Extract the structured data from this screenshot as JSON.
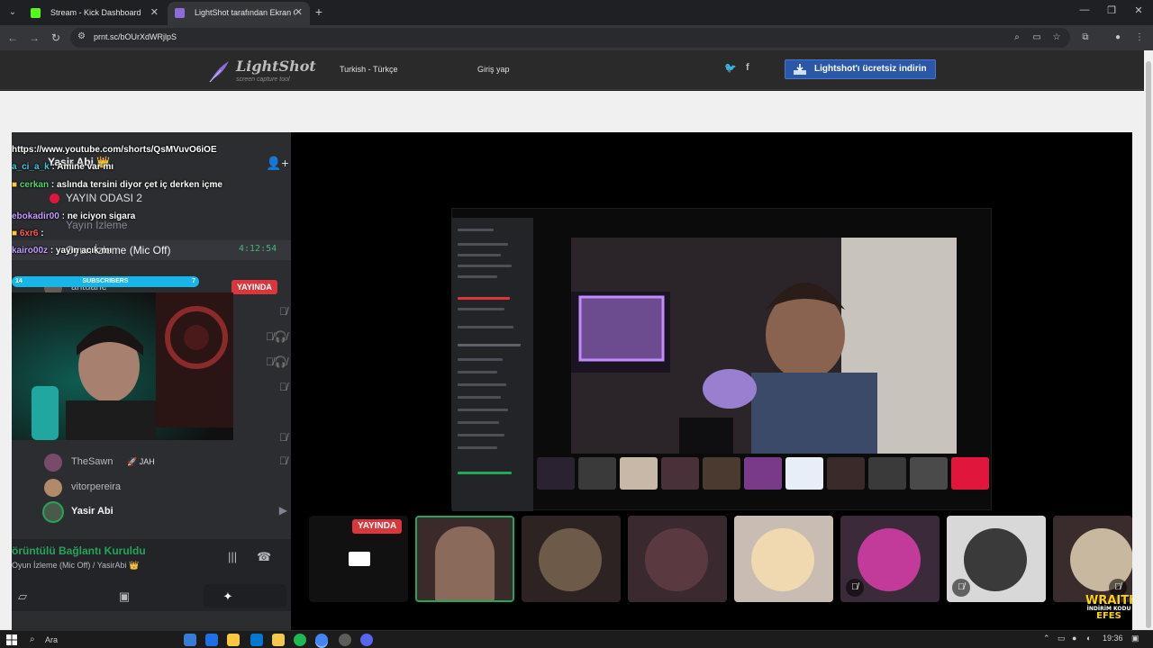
{
  "browser": {
    "tabs": [
      {
        "title": "Stream - Kick Dashboard",
        "favicon_color": "#53fc18",
        "active": false
      },
      {
        "title": "LightShot tarafından Ekran Gör",
        "favicon_color": "#8e6cd8",
        "active": true
      }
    ],
    "url": "prnt.sc/bOUrXdWRjlpS",
    "icons": {
      "back": "back-arrow-icon",
      "forward": "forward-arrow-icon",
      "reload": "reload-icon",
      "zoom": "zoom-icon",
      "cast": "cast-icon",
      "bookmark": "star-icon",
      "extensions": "puzzle-icon",
      "profile": "profile-icon",
      "menu": "kebab-menu-icon"
    }
  },
  "lightshot": {
    "logo": "LightShot",
    "tagline": "screen capture tool",
    "language": "Turkish - Türkçe",
    "login": "Giriş yap",
    "twitter": "twitter-icon",
    "facebook": "facebook-icon",
    "download_button": "Lightshot'ı ücretsiz indirin"
  },
  "discord": {
    "server_name": "Yasir Abi 👑",
    "channels": [
      {
        "name": "YAYIN ODASI 2",
        "live": true
      },
      {
        "name": "Yayın İzleme"
      },
      {
        "name": "Oyun İzleme (Mic Off)",
        "timer": "4:12:54"
      }
    ],
    "users": [
      {
        "name": "antuane",
        "live_badge": "YAYINDA"
      },
      {
        "name": "TheSawn",
        "tag": "🚀 JAH"
      },
      {
        "name": "vitorpereira"
      },
      {
        "name": "Yasir Abi"
      }
    ],
    "connection": {
      "status": "örüntülü Bağlantı Kuruldu",
      "channel": "Oyun İzleme (Mic Off) / YasirAbi 👑"
    }
  },
  "chat": [
    {
      "user": "",
      "text": "https://www.youtube.com/shorts/QsMVuvO6iOE",
      "color": "#ffffff"
    },
    {
      "user": "a_ci_a_k",
      "text": ": Amine var mı",
      "color": "#3fc7e0"
    },
    {
      "user": "cerkan",
      "text": ": aslında tersini diyor çet iç derken içme",
      "color": "#4fd66b"
    },
    {
      "user": "ebokadir00",
      "text": ": ne iciyon sigara",
      "color": "#c59cff"
    },
    {
      "user": "6xr6",
      "text": ":",
      "color": "#ff5a5a"
    },
    {
      "user": "kairo00z",
      "text": ": yayın acık mı",
      "color": "#c59cff"
    }
  ],
  "subs_bar": {
    "left": "14",
    "label": "SUBSCRIBERS",
    "right": "7",
    "progress": 1.0
  },
  "stage": {
    "live_badge": "YAYINDA",
    "overlay": {
      "line1": "WRAITH",
      "line2": "İNDİRİM KODU",
      "line3": "EFES"
    },
    "tiles": [
      {
        "name": "screen-share-tile",
        "color": "#111111"
      },
      {
        "name": "webcam-tile-selected",
        "color": "#3a2a2a"
      },
      {
        "name": "avatar-tile-wolf",
        "color": "#2d2322"
      },
      {
        "name": "avatar-tile-rabbit",
        "color": "#3a2a30"
      },
      {
        "name": "avatar-tile-beetle",
        "color": "#c9bcb3"
      },
      {
        "name": "avatar-tile-dragon",
        "color": "#3b2b3a"
      },
      {
        "name": "avatar-tile-portrait",
        "color": "#d8d8d8"
      },
      {
        "name": "avatar-tile-king",
        "color": "#3a2c2c"
      }
    ]
  },
  "taskbar": {
    "search": "Ara",
    "time": "19:36",
    "apps": [
      "#3a7bd5",
      "#1f6fe5",
      "#ffc83d",
      "#0078d4",
      "#f2c94c",
      "#1db954",
      "#4285f4",
      "#5c5c5c",
      "#5865f2"
    ]
  }
}
